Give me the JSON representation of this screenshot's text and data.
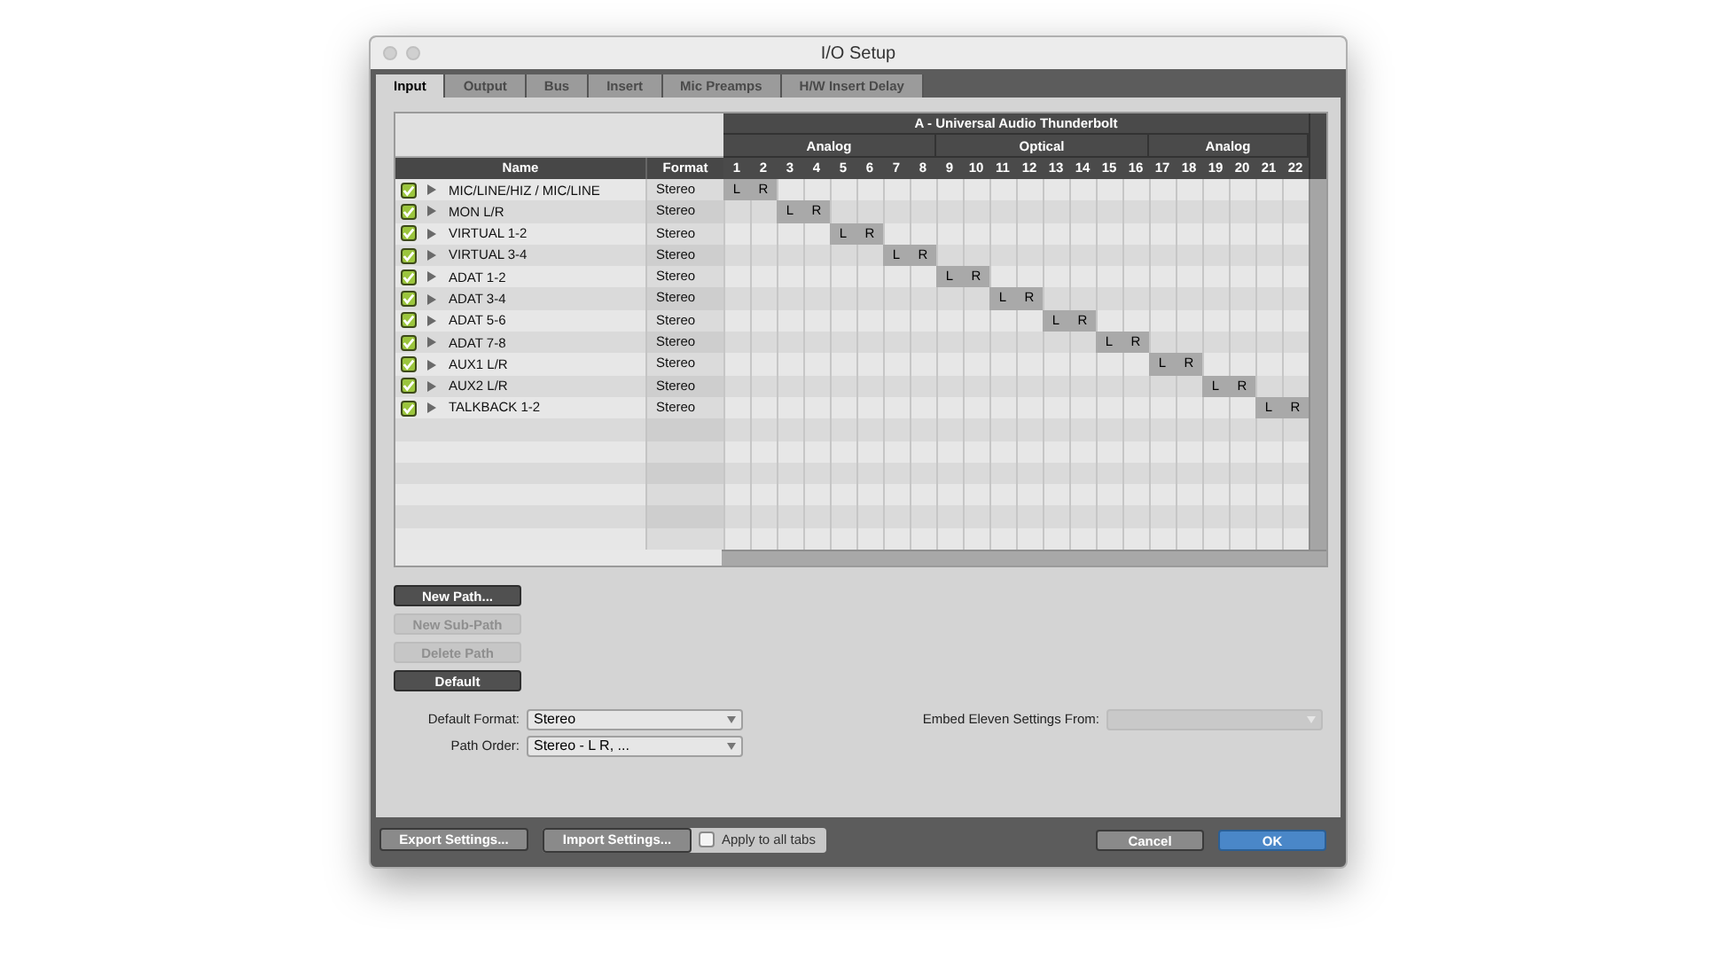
{
  "window": {
    "title": "I/O Setup"
  },
  "tabs": [
    {
      "label": "Input",
      "selected": true
    },
    {
      "label": "Output",
      "selected": false
    },
    {
      "label": "Bus",
      "selected": false
    },
    {
      "label": "Insert",
      "selected": false
    },
    {
      "label": "Mic Preamps",
      "selected": false
    },
    {
      "label": "H/W Insert Delay",
      "selected": false
    }
  ],
  "table": {
    "columns": {
      "name": "Name",
      "format": "Format"
    },
    "device": "A - Universal Audio Thunderbolt",
    "groups": [
      {
        "label": "Analog",
        "columns": [
          "1",
          "2",
          "3",
          "4",
          "5",
          "6",
          "7",
          "8"
        ]
      },
      {
        "label": "Optical",
        "columns": [
          "9",
          "10",
          "11",
          "12",
          "13",
          "14",
          "15",
          "16"
        ]
      },
      {
        "label": "Analog",
        "columns": [
          "17",
          "18",
          "19",
          "20",
          "21",
          "22"
        ]
      }
    ],
    "rows": [
      {
        "checked": true,
        "name": "MIC/LINE/HIZ / MIC/LINE",
        "format": "Stereo",
        "cells": [
          "L",
          "R",
          null,
          null,
          null,
          null,
          null,
          null,
          null,
          null,
          null,
          null,
          null,
          null,
          null,
          null,
          null,
          null,
          null,
          null,
          null,
          null
        ]
      },
      {
        "checked": true,
        "name": "MON L/R",
        "format": "Stereo",
        "cells": [
          null,
          null,
          "L",
          "R",
          null,
          null,
          null,
          null,
          null,
          null,
          null,
          null,
          null,
          null,
          null,
          null,
          null,
          null,
          null,
          null,
          null,
          null
        ]
      },
      {
        "checked": true,
        "name": "VIRTUAL 1-2",
        "format": "Stereo",
        "cells": [
          null,
          null,
          null,
          null,
          "L",
          "R",
          null,
          null,
          null,
          null,
          null,
          null,
          null,
          null,
          null,
          null,
          null,
          null,
          null,
          null,
          null,
          null
        ]
      },
      {
        "checked": true,
        "name": "VIRTUAL 3-4",
        "format": "Stereo",
        "cells": [
          null,
          null,
          null,
          null,
          null,
          null,
          "L",
          "R",
          null,
          null,
          null,
          null,
          null,
          null,
          null,
          null,
          null,
          null,
          null,
          null,
          null,
          null
        ]
      },
      {
        "checked": true,
        "name": "ADAT 1-2",
        "format": "Stereo",
        "cells": [
          null,
          null,
          null,
          null,
          null,
          null,
          null,
          null,
          "L",
          "R",
          null,
          null,
          null,
          null,
          null,
          null,
          null,
          null,
          null,
          null,
          null,
          null
        ]
      },
      {
        "checked": true,
        "name": "ADAT 3-4",
        "format": "Stereo",
        "cells": [
          null,
          null,
          null,
          null,
          null,
          null,
          null,
          null,
          null,
          null,
          "L",
          "R",
          null,
          null,
          null,
          null,
          null,
          null,
          null,
          null,
          null,
          null
        ]
      },
      {
        "checked": true,
        "name": "ADAT 5-6",
        "format": "Stereo",
        "cells": [
          null,
          null,
          null,
          null,
          null,
          null,
          null,
          null,
          null,
          null,
          null,
          null,
          "L",
          "R",
          null,
          null,
          null,
          null,
          null,
          null,
          null,
          null
        ]
      },
      {
        "checked": true,
        "name": "ADAT 7-8",
        "format": "Stereo",
        "cells": [
          null,
          null,
          null,
          null,
          null,
          null,
          null,
          null,
          null,
          null,
          null,
          null,
          null,
          null,
          "L",
          "R",
          null,
          null,
          null,
          null,
          null,
          null
        ]
      },
      {
        "checked": true,
        "name": "AUX1 L/R",
        "format": "Stereo",
        "cells": [
          null,
          null,
          null,
          null,
          null,
          null,
          null,
          null,
          null,
          null,
          null,
          null,
          null,
          null,
          null,
          null,
          "L",
          "R",
          null,
          null,
          null,
          null
        ]
      },
      {
        "checked": true,
        "name": "AUX2 L/R",
        "format": "Stereo",
        "cells": [
          null,
          null,
          null,
          null,
          null,
          null,
          null,
          null,
          null,
          null,
          null,
          null,
          null,
          null,
          null,
          null,
          null,
          null,
          "L",
          "R",
          null,
          null
        ]
      },
      {
        "checked": true,
        "name": "TALKBACK 1-2",
        "format": "Stereo",
        "cells": [
          null,
          null,
          null,
          null,
          null,
          null,
          null,
          null,
          null,
          null,
          null,
          null,
          null,
          null,
          null,
          null,
          null,
          null,
          null,
          null,
          "L",
          "R"
        ]
      }
    ]
  },
  "path_buttons": [
    {
      "label": "New Path...",
      "disabled": false
    },
    {
      "label": "New Sub-Path",
      "disabled": true
    },
    {
      "label": "Delete Path",
      "disabled": true
    },
    {
      "label": "Default",
      "disabled": false
    }
  ],
  "fields": [
    {
      "label": "Default Format:",
      "value": "Stereo"
    },
    {
      "label": "Path Order:",
      "value": "Stereo - L R, ..."
    }
  ],
  "embed": {
    "label": "Embed Eleven Settings From:",
    "disabled": true
  },
  "footer": {
    "export": "Export Settings...",
    "import": "Import Settings...",
    "apply_all": {
      "label": "Apply to all tabs",
      "checked": false
    },
    "cancel": "Cancel",
    "ok": "OK"
  }
}
